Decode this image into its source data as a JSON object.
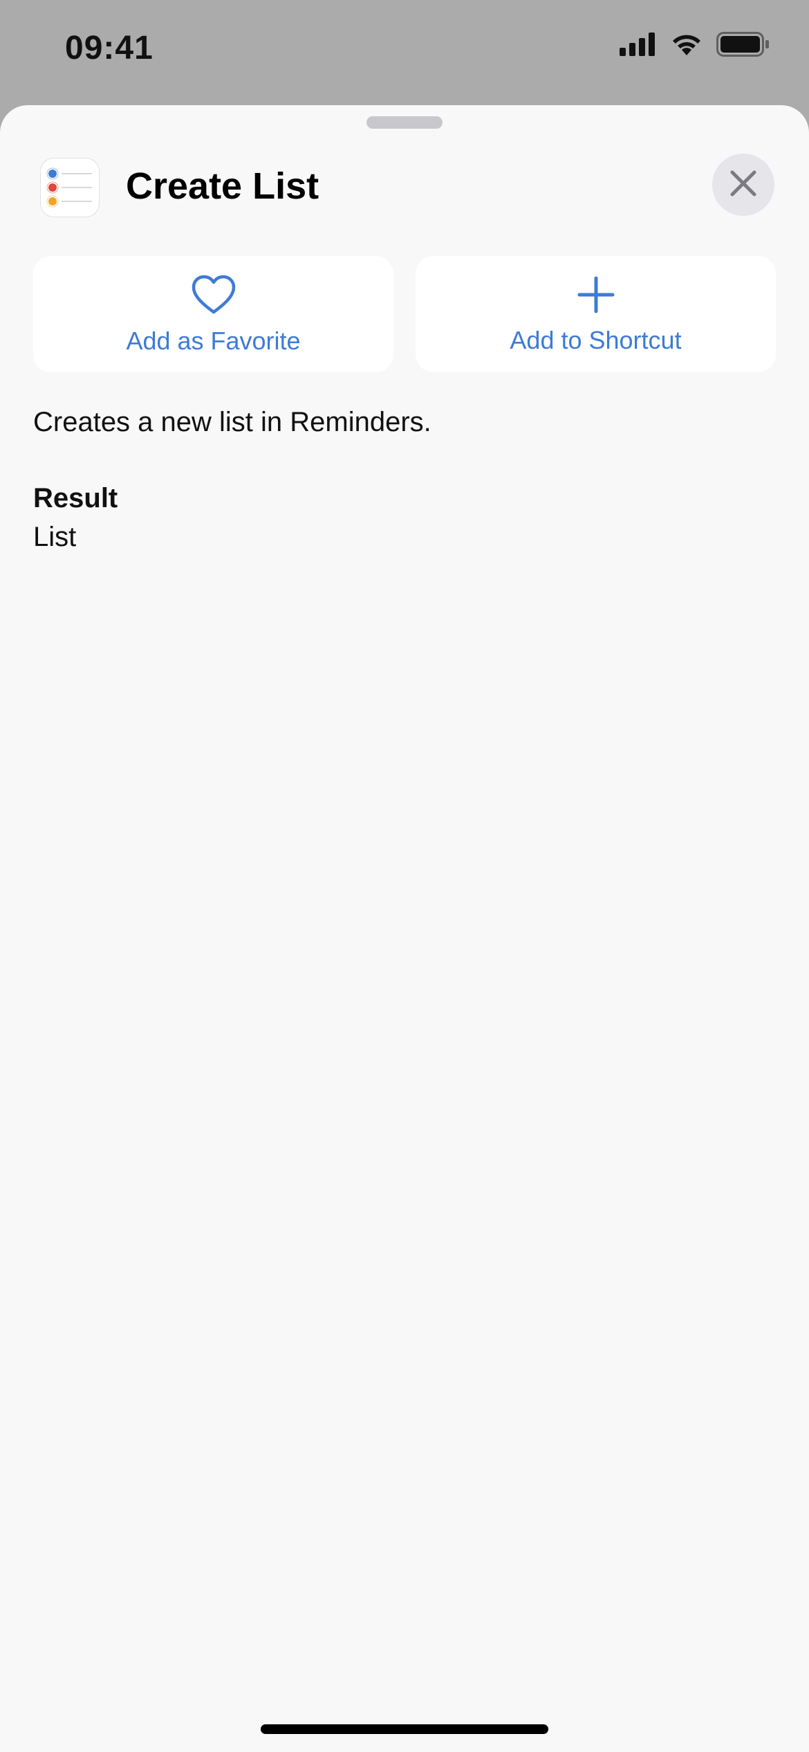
{
  "status_bar": {
    "time": "09:41",
    "icons": [
      "cellular-signal-icon",
      "wifi-icon",
      "battery-icon"
    ]
  },
  "sheet": {
    "header": {
      "app_icon": "reminders-app-icon",
      "title": "Create List",
      "close_icon": "close-icon"
    },
    "actions": [
      {
        "label": "Add as Favorite",
        "icon": "heart-icon"
      },
      {
        "label": "Add to Shortcut",
        "icon": "plus-icon"
      }
    ],
    "description": "Creates a new list in Reminders.",
    "result": {
      "title": "Result",
      "value": "List"
    }
  },
  "colors": {
    "accent": "#3d7bd6",
    "sheet_background": "#f8f8f8",
    "backdrop": "#ababab"
  }
}
